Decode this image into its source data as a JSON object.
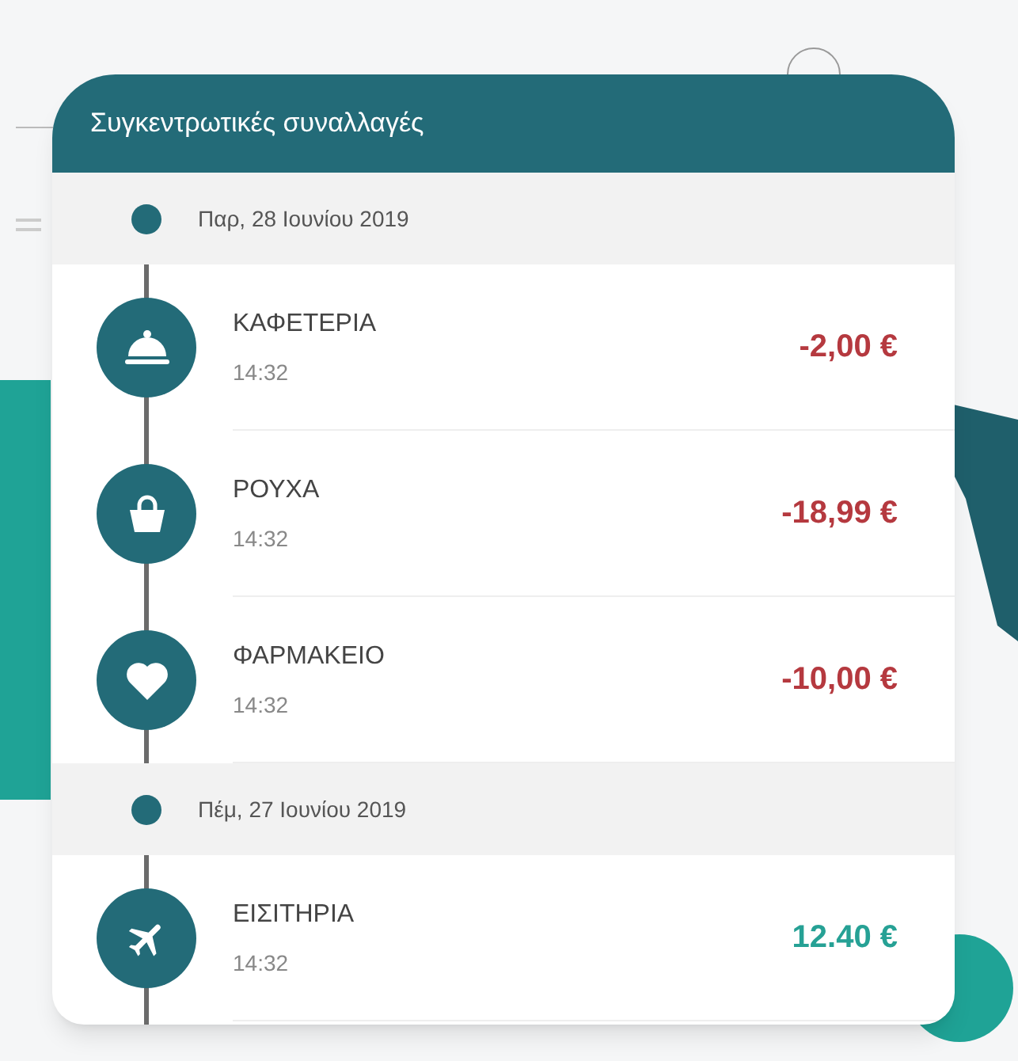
{
  "card": {
    "title": "Συγκεντρωτικές συναλλαγές"
  },
  "entries": [
    {
      "kind": "date",
      "label": "Παρ, 28 Ιουνίου 2019"
    },
    {
      "kind": "transaction",
      "name": "ΚΑΦΕΤΕΡΙΑ",
      "time": "14:32",
      "amount": "-2,00 €",
      "color": "#b5393f"
    },
    {
      "kind": "transaction",
      "name": "ΡΟΥΧΑ",
      "time": "14:32",
      "amount": "-18,99 €",
      "color": "#b5393f"
    },
    {
      "kind": "transaction",
      "name": "ΦΑΡΜΑΚΕΙΟ",
      "time": "14:32",
      "amount": "-10,00 €",
      "color": "#b5393f"
    },
    {
      "kind": "date",
      "label": "Πέμ, 27 Ιουνίου 2019"
    },
    {
      "kind": "transaction",
      "name": "ΕΙΣΙΤΗΡΙΑ",
      "time": "14:32",
      "amount": "12.40 €",
      "color": "#26a195"
    }
  ]
}
